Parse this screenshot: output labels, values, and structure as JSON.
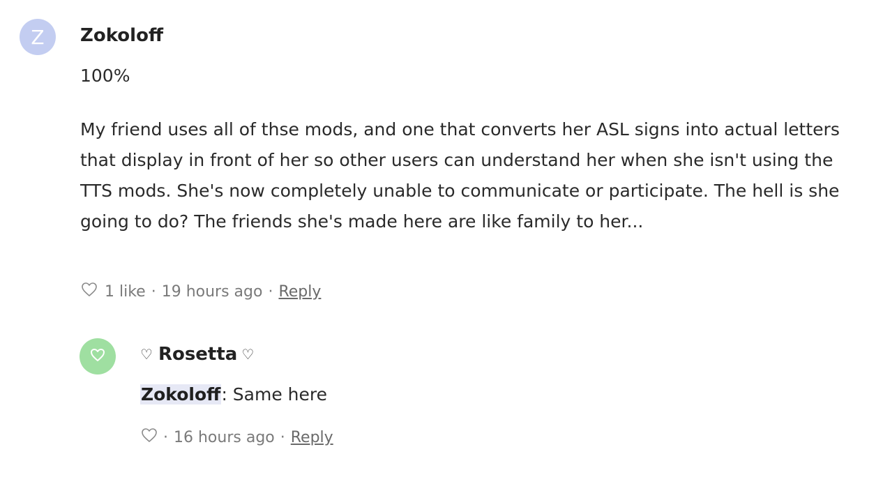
{
  "colors": {
    "avatar_z": "#c3cdf1",
    "avatar_heart": "#9fdfa1",
    "text": "#2a2a2a",
    "meta": "#7a7a7a",
    "mention_bg": "#e6e8f5"
  },
  "comments": [
    {
      "avatar_letter": "Z",
      "author": "Zokoloff",
      "paragraphs": [
        "100%",
        "My friend uses all of thse mods, and one that converts her ASL signs into actual letters that display in front of her so other users can understand her when she isn't using the TTS mods. She's now completely unable to communicate or participate. The hell is she going to do? The friends she's made here are like family to her..."
      ],
      "likes": "1 like",
      "time": "19 hours ago",
      "reply_label": "Reply",
      "separator": "·"
    },
    {
      "avatar_icon": "heart-icon",
      "author_prefix": "♡",
      "author": "Rosetta",
      "author_suffix": "♡",
      "mention": "Zokoloff",
      "text": ": Same here",
      "time": "16 hours ago",
      "reply_label": "Reply",
      "separator": "·"
    }
  ]
}
